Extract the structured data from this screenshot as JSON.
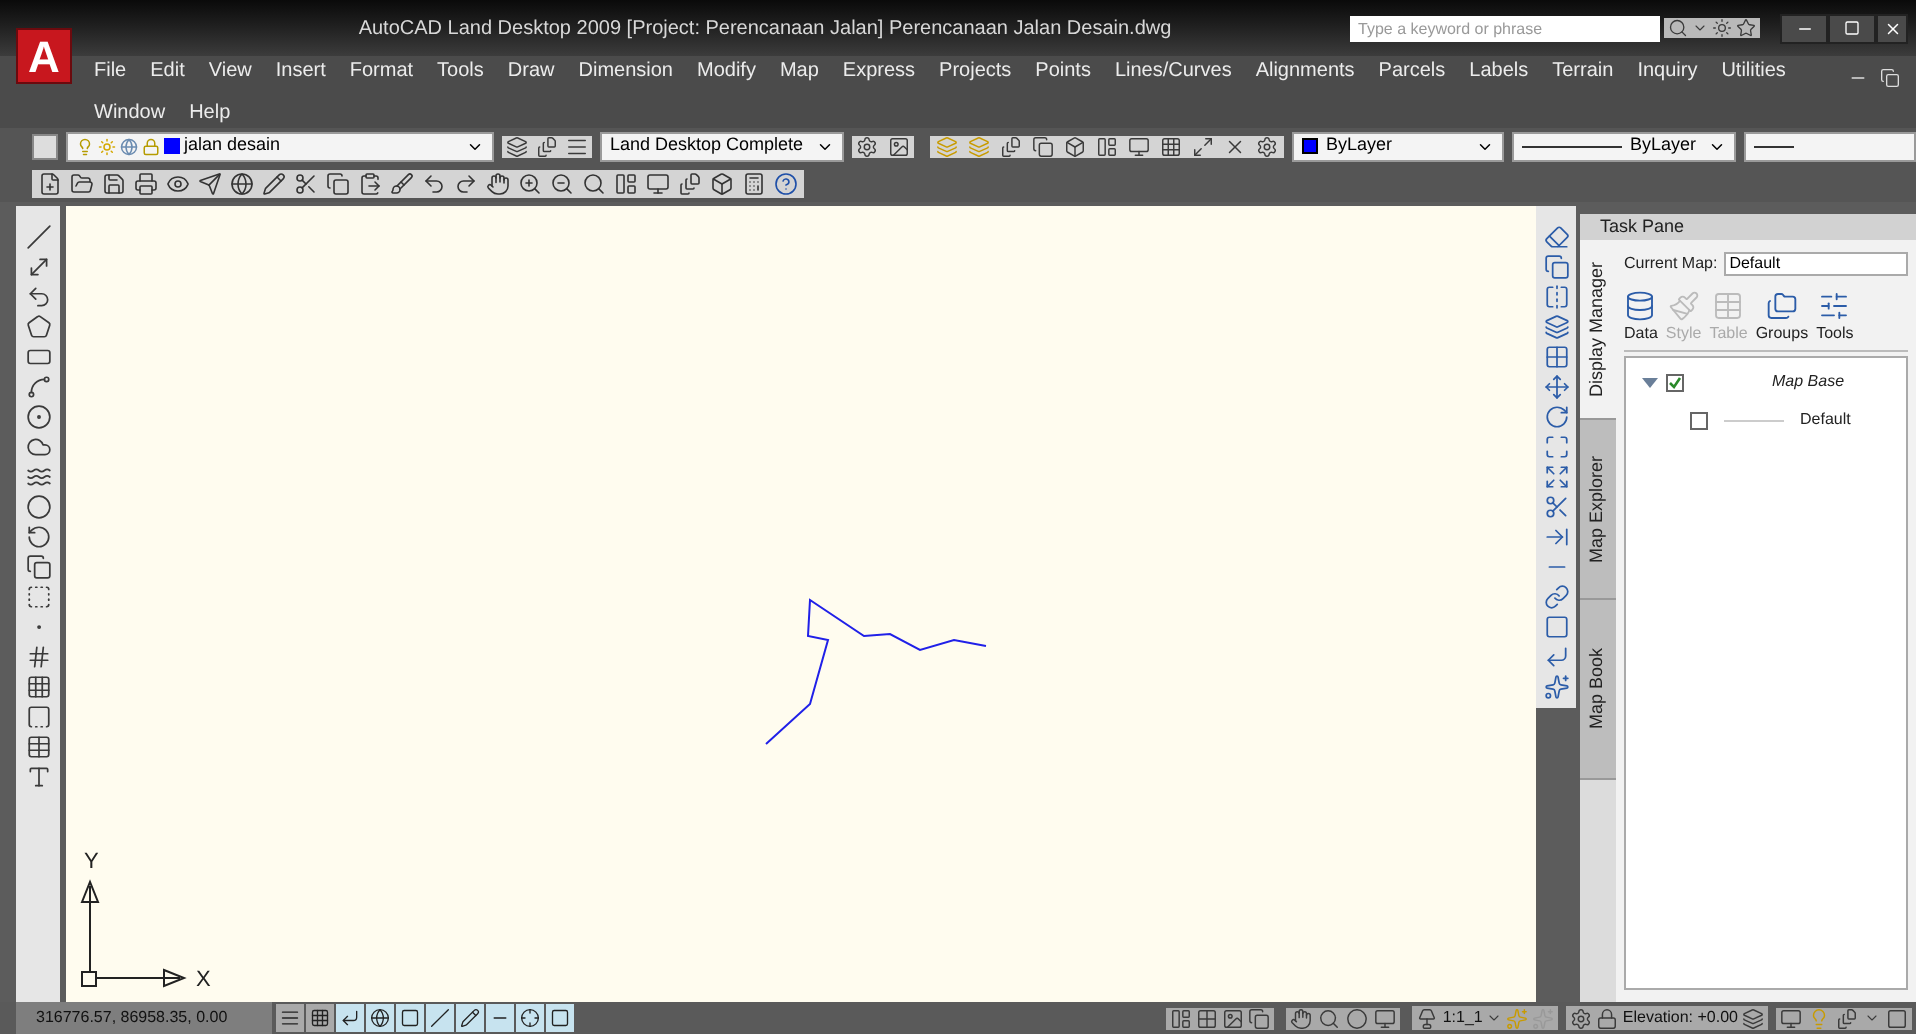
{
  "app": {
    "logo": "A",
    "title": "AutoCAD Land Desktop 2009 [Project: Perencanaan Jalan] Perencanaan Jalan Desain.dwg",
    "search": {
      "placeholder": "Type a keyword or phrase"
    }
  },
  "menu_rows": [
    [
      "File",
      "Edit",
      "View",
      "Insert",
      "Format",
      "Tools",
      "Draw",
      "Dimension",
      "Modify",
      "Map",
      "Express",
      "Projects",
      "Points",
      "Lines/Curves",
      "Alignments",
      "Parcels",
      "Labels",
      "Terrain",
      "Inquiry",
      "Utilities"
    ],
    [
      "Window",
      "Help"
    ]
  ],
  "toolbars": {
    "layer": "jalan desain",
    "workspace": "Land Desktop Complete",
    "color_control": "ByLayer",
    "linetype": "ByLayer"
  },
  "canvas": {
    "ucs_y": "Y",
    "ucs_x": "X"
  },
  "task_pane": {
    "title": "Task Pane",
    "tabs": [
      {
        "label": "Display Manager",
        "selected": true
      },
      {
        "label": "Map Explorer",
        "selected": false
      },
      {
        "label": "Map Book",
        "selected": false
      }
    ],
    "current_map_label": "Current Map:",
    "current_map": "Default",
    "tools": [
      {
        "label": "Data",
        "disabled": false
      },
      {
        "label": "Style",
        "disabled": true
      },
      {
        "label": "Table",
        "disabled": true
      },
      {
        "label": "Groups",
        "disabled": false
      },
      {
        "label": "Tools",
        "disabled": false
      }
    ],
    "layers": [
      {
        "label": "Map Base",
        "checked": true,
        "expanded": true,
        "children": [
          {
            "label": "Default",
            "checked": false
          }
        ]
      }
    ]
  },
  "status_bar": {
    "coordinates": "316776.57, 86958.35, 0.00",
    "scale": "1:1_1",
    "elevation": "Elevation: +0.00"
  }
}
